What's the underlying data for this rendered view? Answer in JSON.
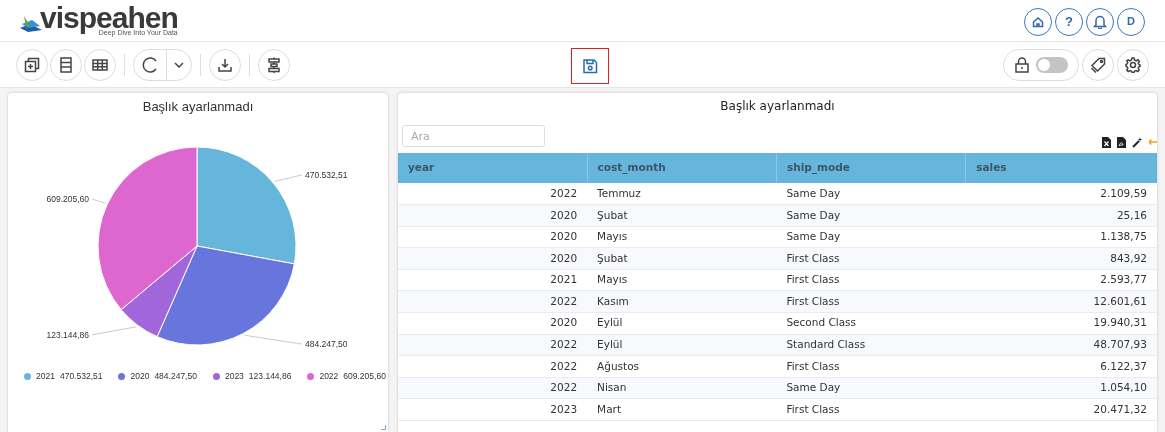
{
  "header": {
    "logo": {
      "name": "vispeahen",
      "tagline": "Deep Dive Into Your Data"
    },
    "help_label": "?",
    "user_initial": "D"
  },
  "toolbar": {
    "save_highlighted": true,
    "lock_toggle": {
      "on": false
    }
  },
  "pie_panel": {
    "title": "Başlık ayarlanmadı",
    "chart_data": {
      "type": "pie",
      "categories": [
        "2021",
        "2020",
        "2023",
        "2022"
      ],
      "series": [
        {
          "values": [
            27.89,
            28.7,
            7.3,
            36.11
          ]
        }
      ],
      "colors": [
        "#66b5db",
        "#6875dc",
        "#a266db",
        "#dd67cf"
      ],
      "value_labels": [
        "470.532,51",
        "484.247,50",
        "123.144,86",
        "609.205,60"
      ]
    },
    "legend": [
      {
        "value": "470.532,51",
        "color": "#66b5db"
      },
      {
        "value": "484.247,50",
        "color": "#6875dc"
      },
      {
        "value": "123.144,86",
        "color": "#a266db"
      },
      {
        "value": "609.205,60",
        "color": "#dd67cf"
      }
    ]
  },
  "table_panel": {
    "title": "Başlık ayarlanmadı",
    "search": {
      "placeholder": "Ara"
    },
    "columns": [
      "year",
      "cost_month",
      "ship_mode",
      "sales"
    ],
    "rows": [
      [
        "2022",
        "Temmuz",
        "Same Day",
        "2.109,59"
      ],
      [
        "2020",
        "Şubat",
        "Same Day",
        "25,16"
      ],
      [
        "2020",
        "Mayıs",
        "Same Day",
        "1.138,75"
      ],
      [
        "2020",
        "Şubat",
        "First Class",
        "843,92"
      ],
      [
        "2021",
        "Mayıs",
        "First Class",
        "2.593,77"
      ],
      [
        "2022",
        "Kasım",
        "First Class",
        "12.601,61"
      ],
      [
        "2020",
        "Eylül",
        "Second Class",
        "19.940,31"
      ],
      [
        "2022",
        "Eylül",
        "Standard Class",
        "48.707,93"
      ],
      [
        "2022",
        "Ağustos",
        "First Class",
        "6.122,37"
      ],
      [
        "2022",
        "Nisan",
        "Same Day",
        "1.054,10"
      ],
      [
        "2023",
        "Mart",
        "First Class",
        "20.471,32"
      ]
    ]
  }
}
